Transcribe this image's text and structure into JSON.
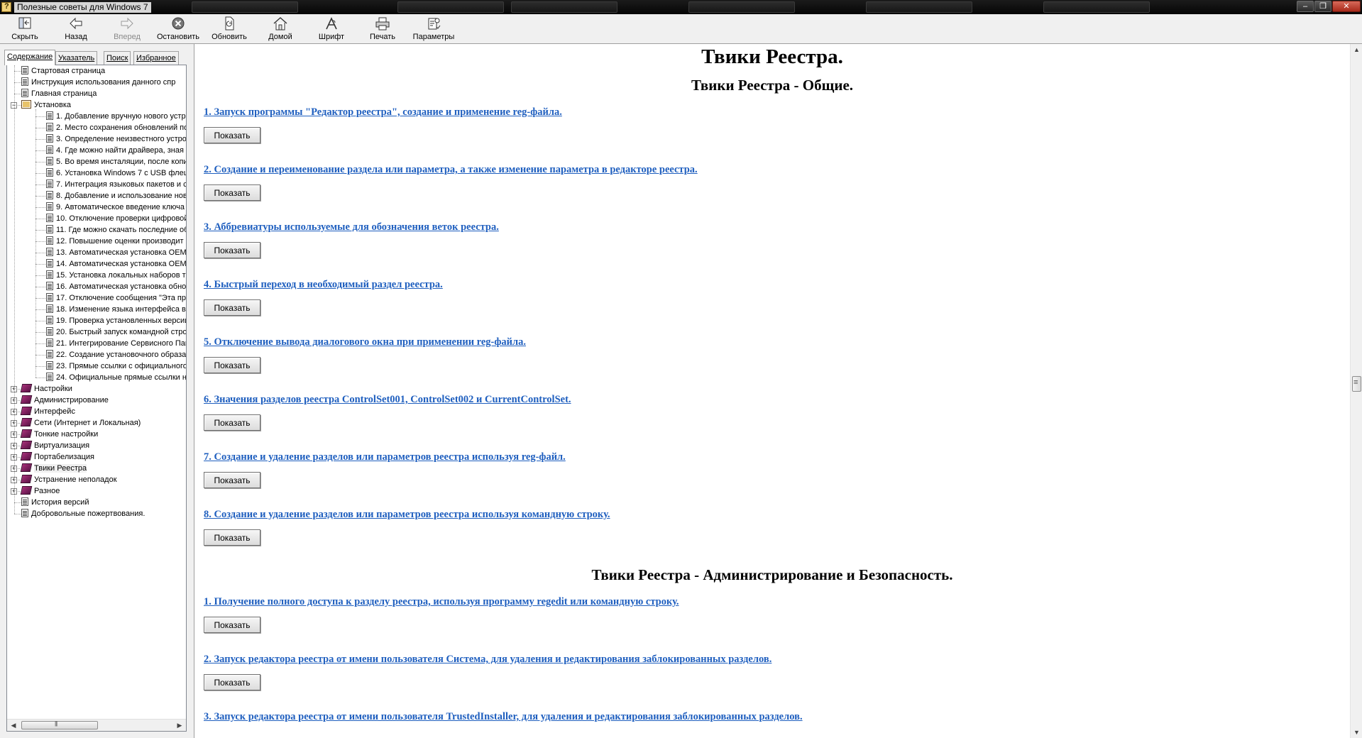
{
  "window": {
    "title": "Полезные советы для Windows 7",
    "buttons": {
      "minimize": "‒",
      "maximize": "❐",
      "close": "✕"
    }
  },
  "toolbar": {
    "buttons": [
      {
        "label": "Скрыть",
        "icon": "hide-pane-icon",
        "enabled": true
      },
      {
        "label": "Назад",
        "icon": "back-arrow-icon",
        "enabled": true
      },
      {
        "label": "Вперед",
        "icon": "forward-arrow-icon",
        "enabled": false
      },
      {
        "label": "Остановить",
        "icon": "stop-icon",
        "enabled": true
      },
      {
        "label": "Обновить",
        "icon": "refresh-icon",
        "enabled": true
      },
      {
        "label": "Домой",
        "icon": "home-icon",
        "enabled": true
      },
      {
        "label": "Шрифт",
        "icon": "font-icon",
        "enabled": true
      },
      {
        "label": "Печать",
        "icon": "print-icon",
        "enabled": true
      },
      {
        "label": "Параметры",
        "icon": "options-icon",
        "enabled": true
      }
    ]
  },
  "nav_tabs": [
    {
      "label": "Содержание",
      "active": true
    },
    {
      "label": "Указатель",
      "active": false
    },
    {
      "label": "Поиск",
      "active": false
    },
    {
      "label": "Избранное",
      "active": false
    }
  ],
  "tree": {
    "items": [
      {
        "label": "Стартовая страница",
        "type": "page",
        "level": 1
      },
      {
        "label": "Инструкция использования данного спр",
        "type": "page",
        "level": 1
      },
      {
        "label": "Главная страница",
        "type": "page",
        "level": 1
      },
      {
        "label": "Установка",
        "type": "book-open",
        "level": 0,
        "expander": "−"
      },
      {
        "label": "1. Добавление вручную нового устр",
        "type": "page",
        "level": 2
      },
      {
        "label": "2. Место сохранения обновлений по",
        "type": "page",
        "level": 2
      },
      {
        "label": "3. Определение неизвестного устро",
        "type": "page",
        "level": 2
      },
      {
        "label": "4. Где можно найти драйвера, зная '",
        "type": "page",
        "level": 2
      },
      {
        "label": "5. Во время инсталяции, после копи",
        "type": "page",
        "level": 2
      },
      {
        "label": "6. Установка Windows 7 с USB флеш",
        "type": "page",
        "level": 2
      },
      {
        "label": "7. Интеграция языковых пакетов и с",
        "type": "page",
        "level": 2
      },
      {
        "label": "8. Добавление и использование нов",
        "type": "page",
        "level": 2
      },
      {
        "label": "9. Автоматическое введение ключа",
        "type": "page",
        "level": 2
      },
      {
        "label": "10. Отключение проверки цифровой",
        "type": "page",
        "level": 2
      },
      {
        "label": "11. Где можно скачать последние об",
        "type": "page",
        "level": 2
      },
      {
        "label": "12. Повышение оценки производит",
        "type": "page",
        "level": 2
      },
      {
        "label": "13. Автоматическая установка OEM",
        "type": "page",
        "level": 2
      },
      {
        "label": "14. Автоматическая установка OEM",
        "type": "page",
        "level": 2
      },
      {
        "label": "15. Установка локальных наборов т",
        "type": "page",
        "level": 2
      },
      {
        "label": "16. Автоматическая установка обно",
        "type": "page",
        "level": 2
      },
      {
        "label": "17. Отключение сообщения \"Эта про",
        "type": "page",
        "level": 2
      },
      {
        "label": "18. Изменение языка интерфейса в",
        "type": "page",
        "level": 2
      },
      {
        "label": "19. Проверка установленных версии",
        "type": "page",
        "level": 2
      },
      {
        "label": "20. Быстрый запуск командной стро",
        "type": "page",
        "level": 2
      },
      {
        "label": "21. Интегрирование Сервисного Пак",
        "type": "page",
        "level": 2
      },
      {
        "label": "22. Создание установочного образа",
        "type": "page",
        "level": 2
      },
      {
        "label": "23. Прямые ссылки с официального",
        "type": "page",
        "level": 2
      },
      {
        "label": "24. Официальные прямые ссылки на",
        "type": "page",
        "level": 2
      },
      {
        "label": "Настройки",
        "type": "book",
        "level": 0,
        "expander": "+"
      },
      {
        "label": "Администрирование",
        "type": "book",
        "level": 0,
        "expander": "+"
      },
      {
        "label": "Интерфейс",
        "type": "book",
        "level": 0,
        "expander": "+"
      },
      {
        "label": "Сети (Интернет и Локальная)",
        "type": "book",
        "level": 0,
        "expander": "+"
      },
      {
        "label": "Тонкие настройки",
        "type": "book",
        "level": 0,
        "expander": "+"
      },
      {
        "label": "Виртуализация",
        "type": "book",
        "level": 0,
        "expander": "+"
      },
      {
        "label": "Портабелизация",
        "type": "book",
        "level": 0,
        "expander": "+"
      },
      {
        "label": "Твики Реестра",
        "type": "book",
        "level": 0,
        "expander": "+",
        "selected": true
      },
      {
        "label": "Устранение неполадок",
        "type": "book",
        "level": 0,
        "expander": "+"
      },
      {
        "label": "Разное",
        "type": "book",
        "level": 0,
        "expander": "+"
      },
      {
        "label": "История версий",
        "type": "page",
        "level": 1
      },
      {
        "label": "Добровольные пожертвования.",
        "type": "page",
        "level": 1
      }
    ]
  },
  "content": {
    "title": "Твики Реестра.",
    "sections": [
      {
        "title": "Твики Реестра - Общие.",
        "items": [
          "1. Запуск программы \"Редактор реестра\", создание и применение reg-файла.",
          "2. Создание и переименование раздела или параметра, а также изменение параметра в редакторе реестра.",
          "3. Аббревиатуры используемые для обозначения веток реестра.",
          "4. Быстрый переход в необходимый раздел реестра.",
          "5. Отключение вывода диалогового окна при применении reg-файла.",
          "6. Значения разделов реестра ControlSet001, ControlSet002 и CurrentControlSet.",
          "7. Создание и удаление разделов или параметров реестра используя reg-файл.",
          "8. Создание и удаление разделов или параметров реестра используя командную строку."
        ]
      },
      {
        "title": "Твики Реестра - Администрирование и Безопасность.",
        "items": [
          "1. Получение полного доступа к разделу реестра, используя программу regedit или командную строку.",
          "2. Запуск редактора реестра от имени пользователя Система, для удаления и редактирования заблокированных разделов.",
          "3. Запуск редактора реестра от имени пользователя TrustedInstaller, для удаления и редактирования заблокированных разделов."
        ]
      }
    ],
    "show_button_label": "Показать",
    "link_color": "#1f5fbf"
  }
}
